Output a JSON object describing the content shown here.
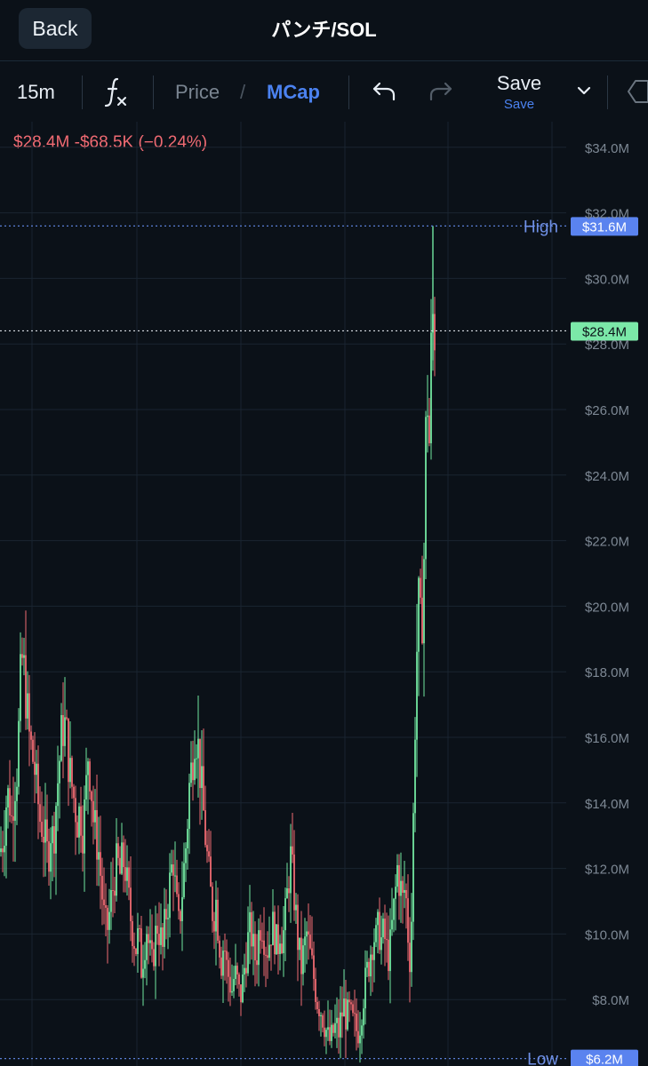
{
  "header": {
    "back_label": "Back",
    "title": "パンチ/SOL"
  },
  "toolbar": {
    "interval": "15m",
    "indicator_icon": "fx-icon",
    "price_tab": "Price",
    "separator": "/",
    "mcap_tab": "MCap",
    "save_label": "Save",
    "save_sub": "Save"
  },
  "colors": {
    "up": "#72e6a0",
    "down": "#ef6a72",
    "accent": "#4b82f0",
    "background": "#0b1118"
  },
  "chart_data": {
    "type": "candlestick",
    "change_text": "$28.4M  -$68.5K (−0.24%)",
    "y_unit": "$M",
    "ylim": [
      6.0,
      34.6
    ],
    "ytick_values": [
      8,
      10,
      12,
      14,
      16,
      18,
      20,
      22,
      24,
      26,
      28,
      30,
      32,
      34
    ],
    "ytick_labels": [
      "$8.0M",
      "$10.0M",
      "$12.0M",
      "$14.0M",
      "$16.0M",
      "$18.0M",
      "$20.0M",
      "$22.0M",
      "$24.0M",
      "$26.0M",
      "$28.0M",
      "$30.0M",
      "$32.0M",
      "$34.0M"
    ],
    "high": {
      "value": 31.6,
      "label": "High",
      "price_label": "$31.6M"
    },
    "low": {
      "value": 6.2,
      "label": "Low",
      "price_label": "$6.2M"
    },
    "last": {
      "value": 28.4,
      "price_label": "$28.4M"
    },
    "grid": true,
    "series_path": [
      [
        0,
        12.5
      ],
      [
        4,
        13.0
      ],
      [
        7,
        14.0
      ],
      [
        10,
        14.3
      ],
      [
        13,
        13.5
      ],
      [
        16,
        14.5
      ],
      [
        19,
        15.0
      ],
      [
        22,
        16.8
      ],
      [
        24,
        18.5
      ],
      [
        27,
        18.0
      ],
      [
        30,
        17.0
      ],
      [
        33,
        16.0
      ],
      [
        36,
        15.5
      ],
      [
        39,
        15.0
      ],
      [
        42,
        14.2
      ],
      [
        45,
        13.5
      ],
      [
        48,
        13.3
      ],
      [
        51,
        12.8
      ],
      [
        54,
        12.3
      ],
      [
        57,
        13.2
      ],
      [
        60,
        12.8
      ],
      [
        63,
        14.0
      ],
      [
        66,
        15.0
      ],
      [
        69,
        16.0
      ],
      [
        72,
        16.5
      ],
      [
        75,
        16.0
      ],
      [
        78,
        15.0
      ],
      [
        81,
        14.5
      ],
      [
        84,
        14.0
      ],
      [
        87,
        13.5
      ],
      [
        90,
        13.8
      ],
      [
        93,
        13.2
      ],
      [
        96,
        14.0
      ],
      [
        99,
        15.5
      ],
      [
        102,
        14.8
      ],
      [
        105,
        13.5
      ],
      [
        108,
        13.0
      ],
      [
        111,
        12.5
      ],
      [
        114,
        11.5
      ],
      [
        117,
        10.5
      ],
      [
        120,
        10.0
      ],
      [
        123,
        10.6
      ],
      [
        126,
        11.2
      ],
      [
        129,
        11.8
      ],
      [
        132,
        12.2
      ],
      [
        135,
        11.8
      ],
      [
        138,
        12.3
      ],
      [
        141,
        12.0
      ],
      [
        144,
        11.2
      ],
      [
        147,
        10.5
      ],
      [
        150,
        10.0
      ],
      [
        153,
        9.6
      ],
      [
        156,
        10.0
      ],
      [
        159,
        9.0
      ],
      [
        162,
        9.6
      ],
      [
        165,
        10.2
      ],
      [
        168,
        9.5
      ],
      [
        171,
        9.0
      ],
      [
        174,
        9.8
      ],
      [
        177,
        10.3
      ],
      [
        180,
        10.0
      ],
      [
        183,
        9.5
      ],
      [
        186,
        10.5
      ],
      [
        189,
        11.0
      ],
      [
        192,
        11.8
      ],
      [
        195,
        12.3
      ],
      [
        198,
        11.0
      ],
      [
        201,
        10.2
      ],
      [
        204,
        11.0
      ],
      [
        207,
        12.0
      ],
      [
        210,
        13.0
      ],
      [
        213,
        14.5
      ],
      [
        216,
        15.2
      ],
      [
        219,
        16.2
      ],
      [
        222,
        16.0
      ],
      [
        225,
        15.0
      ],
      [
        228,
        14.0
      ],
      [
        231,
        13.0
      ],
      [
        234,
        12.0
      ],
      [
        237,
        11.2
      ],
      [
        240,
        10.5
      ],
      [
        243,
        11.0
      ],
      [
        246,
        10.0
      ],
      [
        249,
        9.2
      ],
      [
        252,
        9.8
      ],
      [
        255,
        9.0
      ],
      [
        258,
        8.6
      ],
      [
        261,
        8.3
      ],
      [
        264,
        8.8
      ],
      [
        267,
        8.5
      ],
      [
        270,
        8.0
      ],
      [
        273,
        8.5
      ],
      [
        276,
        9.2
      ],
      [
        279,
        9.8
      ],
      [
        282,
        10.2
      ],
      [
        285,
        9.5
      ],
      [
        288,
        9.2
      ],
      [
        291,
        10.0
      ],
      [
        294,
        10.5
      ],
      [
        297,
        10.0
      ],
      [
        300,
        9.5
      ],
      [
        303,
        9.8
      ],
      [
        306,
        10.3
      ],
      [
        309,
        10.0
      ],
      [
        312,
        9.5
      ],
      [
        315,
        10.2
      ],
      [
        318,
        9.8
      ],
      [
        321,
        10.5
      ],
      [
        324,
        11.5
      ],
      [
        327,
        12.3
      ],
      [
        330,
        11.5
      ],
      [
        333,
        10.5
      ],
      [
        336,
        9.5
      ],
      [
        339,
        9.0
      ],
      [
        342,
        9.5
      ],
      [
        345,
        10.0
      ],
      [
        348,
        9.5
      ],
      [
        351,
        9.0
      ],
      [
        354,
        8.5
      ],
      [
        357,
        8.0
      ],
      [
        360,
        7.8
      ],
      [
        363,
        7.5
      ],
      [
        366,
        7.2
      ],
      [
        369,
        6.8
      ],
      [
        372,
        6.7
      ],
      [
        375,
        7.0
      ],
      [
        378,
        7.2
      ],
      [
        381,
        7.0
      ],
      [
        384,
        7.5
      ],
      [
        387,
        7.8
      ],
      [
        390,
        7.4
      ],
      [
        393,
        7.6
      ],
      [
        396,
        7.3
      ],
      [
        399,
        7.2
      ],
      [
        402,
        7.0
      ],
      [
        405,
        7.3
      ],
      [
        408,
        8.0
      ],
      [
        411,
        8.5
      ],
      [
        414,
        9.0
      ],
      [
        417,
        9.5
      ],
      [
        420,
        10.0
      ],
      [
        423,
        9.8
      ],
      [
        426,
        10.2
      ],
      [
        429,
        9.8
      ],
      [
        432,
        10.0
      ],
      [
        435,
        9.5
      ],
      [
        438,
        9.3
      ],
      [
        441,
        10.2
      ],
      [
        444,
        11.0
      ],
      [
        447,
        12.0
      ],
      [
        450,
        11.5
      ],
      [
        453,
        11.0
      ],
      [
        456,
        11.5
      ],
      [
        459,
        10.0
      ],
      [
        462,
        9.0
      ],
      [
        465,
        13.5
      ],
      [
        468,
        18.0
      ],
      [
        471,
        20.0
      ],
      [
        474,
        19.0
      ],
      [
        477,
        21.5
      ],
      [
        480,
        27.0
      ],
      [
        483,
        25.0
      ],
      [
        486,
        29.0
      ],
      [
        488,
        28.6
      ],
      [
        490,
        28.4
      ]
    ]
  }
}
